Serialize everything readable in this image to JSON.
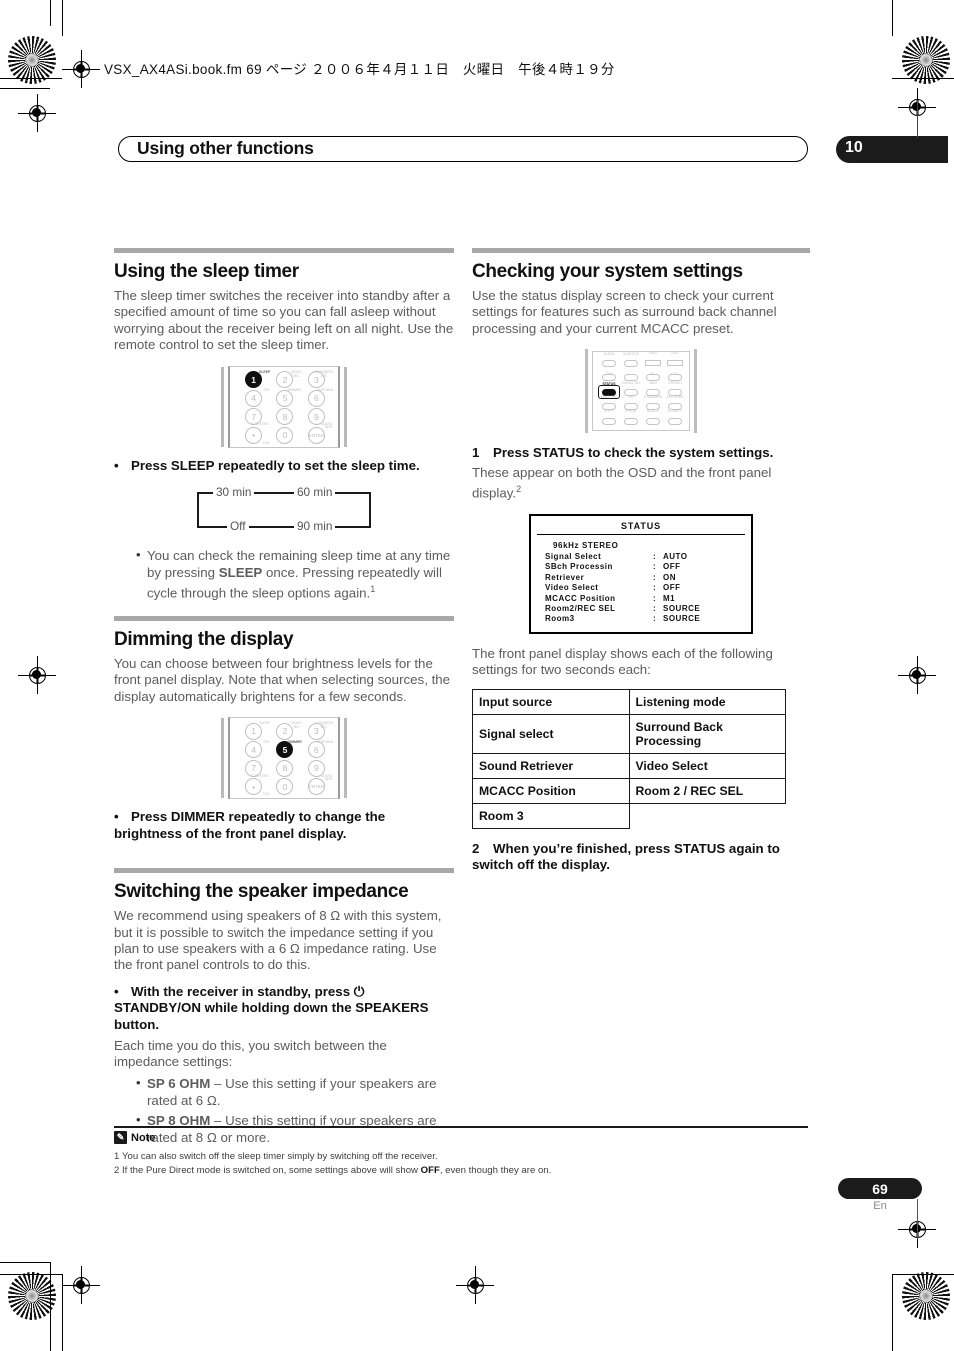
{
  "print_header": {
    "filename_line": "VSX_AX4ASi.book.fm  69 ページ  ２００６年４月１１日　火曜日　午後４時１９分"
  },
  "chapter": {
    "title": "Using other functions",
    "number": "10"
  },
  "left_column": {
    "sleep": {
      "heading": "Using the sleep timer",
      "intro": "The sleep timer switches the receiver into standby after a specified amount of time so you can fall asleep without worrying about the receiver being left on all night. Use the remote control to set the sleep timer.",
      "remote": {
        "highlight_key": "1",
        "highlight_label": "SLEEP",
        "keys": [
          {
            "num": "1",
            "label": "SLEEP",
            "pos": "tr"
          },
          {
            "num": "2",
            "label": "VIDEO SEL",
            "pos": "tr"
          },
          {
            "num": "3",
            "label": "LOUDNESS ATT",
            "pos": "tr"
          },
          {
            "num": "4",
            "label": "SR+",
            "pos": "tr"
          },
          {
            "num": "5",
            "label": "DIMMER",
            "pos": "tr"
          },
          {
            "num": "6",
            "label": "ANTENNA",
            "pos": "tr"
          },
          {
            "num": "7",
            "label": "S.RETRIEV",
            "pos": "br"
          },
          {
            "num": "8",
            "label": "",
            "pos": "tr"
          },
          {
            "num": "9",
            "label": "CLASS",
            "pos": "br"
          },
          {
            "num": "•",
            "label": "TUN",
            "pos": "tr"
          },
          {
            "num": "0",
            "label": "",
            "pos": "tr"
          },
          {
            "num": "ENTER",
            "label": "DISC",
            "pos": "tr"
          }
        ]
      },
      "instruction": "Press SLEEP repeatedly to set the sleep time.",
      "cycle": {
        "top_left": "30 min",
        "top_right": "60 min",
        "bottom_left": "Off",
        "bottom_right": "90 min"
      },
      "note_bullet_pre": "You can check the remaining sleep time at any time by pressing ",
      "note_bullet_bold": "SLEEP",
      "note_bullet_post": " once. Pressing repeatedly will cycle through the sleep options again.",
      "note_bullet_sup": "1"
    },
    "dimmer": {
      "heading": "Dimming the display",
      "intro": "You can choose between four brightness levels for the front panel display. Note that when selecting sources, the display automatically brightens for a few seconds.",
      "remote": {
        "highlight_key": "5",
        "highlight_label": "DIMMER"
      },
      "instruction": "Press DIMMER repeatedly to change the brightness of the front panel display."
    },
    "impedance": {
      "heading": "Switching the speaker impedance",
      "intro": "We recommend using speakers of 8 Ω with this system, but it is possible to switch the impedance setting if you plan to use speakers with a 6 Ω impedance rating. Use the front panel controls to do this.",
      "instruction": "With the receiver in standby, press ⏻ STANDBY/ON while holding down the SPEAKERS button.",
      "after_instruction": "Each time you do this, you switch between the impedance settings:",
      "options": [
        {
          "name": "SP 6 OHM",
          "desc": " – Use this setting if your speakers are rated at 6 Ω."
        },
        {
          "name": "SP 8 OHM",
          "desc": " – Use this setting if your speakers are rated at 8 Ω or more."
        }
      ]
    }
  },
  "right_column": {
    "status": {
      "heading": "Checking your system settings",
      "intro": "Use the status display screen to check your current settings for features such as surround back channel processing and your current MCACC preset.",
      "remote": {
        "highlight_label": "STATUS",
        "row_labels": [
          [
            "AUDIO",
            "SUBTITLE",
            "HDD",
            "DVD"
          ],
          [
            "DISP",
            "",
            "CH –",
            "CH +"
          ],
          [
            "STATUS",
            "SIGNAL SEL",
            "MIDI",
            "STEREO"
          ],
          [
            "MULT OPE",
            "THX",
            "STANDARD",
            "ADV SURR"
          ],
          [
            "SHIFT",
            "PHASE",
            "MCACC",
            "S.DIRECT"
          ]
        ],
        "sub_labels": [
          "PHOTO"
        ]
      },
      "step1": {
        "num": "1",
        "bold": "Press STATUS to check the system settings.",
        "text_pre": "These appear on both the OSD and the front panel display.",
        "sup": "2"
      },
      "osd": {
        "title": "STATUS",
        "first_line": "96kHz  STEREO",
        "rows": [
          {
            "key": "Signal Select",
            "sep": ":",
            "value": "AUTO"
          },
          {
            "key": "SBch Processin",
            "sep": ":",
            "value": "OFF"
          },
          {
            "key": "Retriever",
            "sep": ":",
            "value": "ON"
          },
          {
            "key": "Video Select",
            "sep": ":",
            "value": "OFF"
          },
          {
            "key": "MCACC Position",
            "sep": ":",
            "value": "M1"
          },
          {
            "key": "Room2/REC SEL",
            "sep": ":",
            "value": "SOURCE"
          },
          {
            "key": "Room3",
            "sep": ":",
            "value": "SOURCE"
          }
        ]
      },
      "table_intro": "The front panel display shows each of the following settings for two seconds each:",
      "table_rows": [
        [
          "Input source",
          "Listening mode"
        ],
        [
          "Signal select",
          "Surround Back Processing"
        ],
        [
          "Sound Retriever",
          "Video Select"
        ],
        [
          "MCACC Position",
          "Room 2 / REC SEL"
        ],
        [
          "Room 3",
          ""
        ]
      ],
      "step2": {
        "num": "2",
        "bold": "When you’re finished, press STATUS again to switch off the display."
      }
    }
  },
  "footer": {
    "note_label": "Note",
    "notes": [
      {
        "num": "1",
        "text": "You can also switch off the sleep timer simply by switching off the receiver."
      },
      {
        "num": "2",
        "pre": "If the Pure Direct mode is switched on, some settings above will show ",
        "bold": "OFF",
        "post": ", even though they are on."
      }
    ],
    "page_number": "69",
    "language": "En"
  }
}
